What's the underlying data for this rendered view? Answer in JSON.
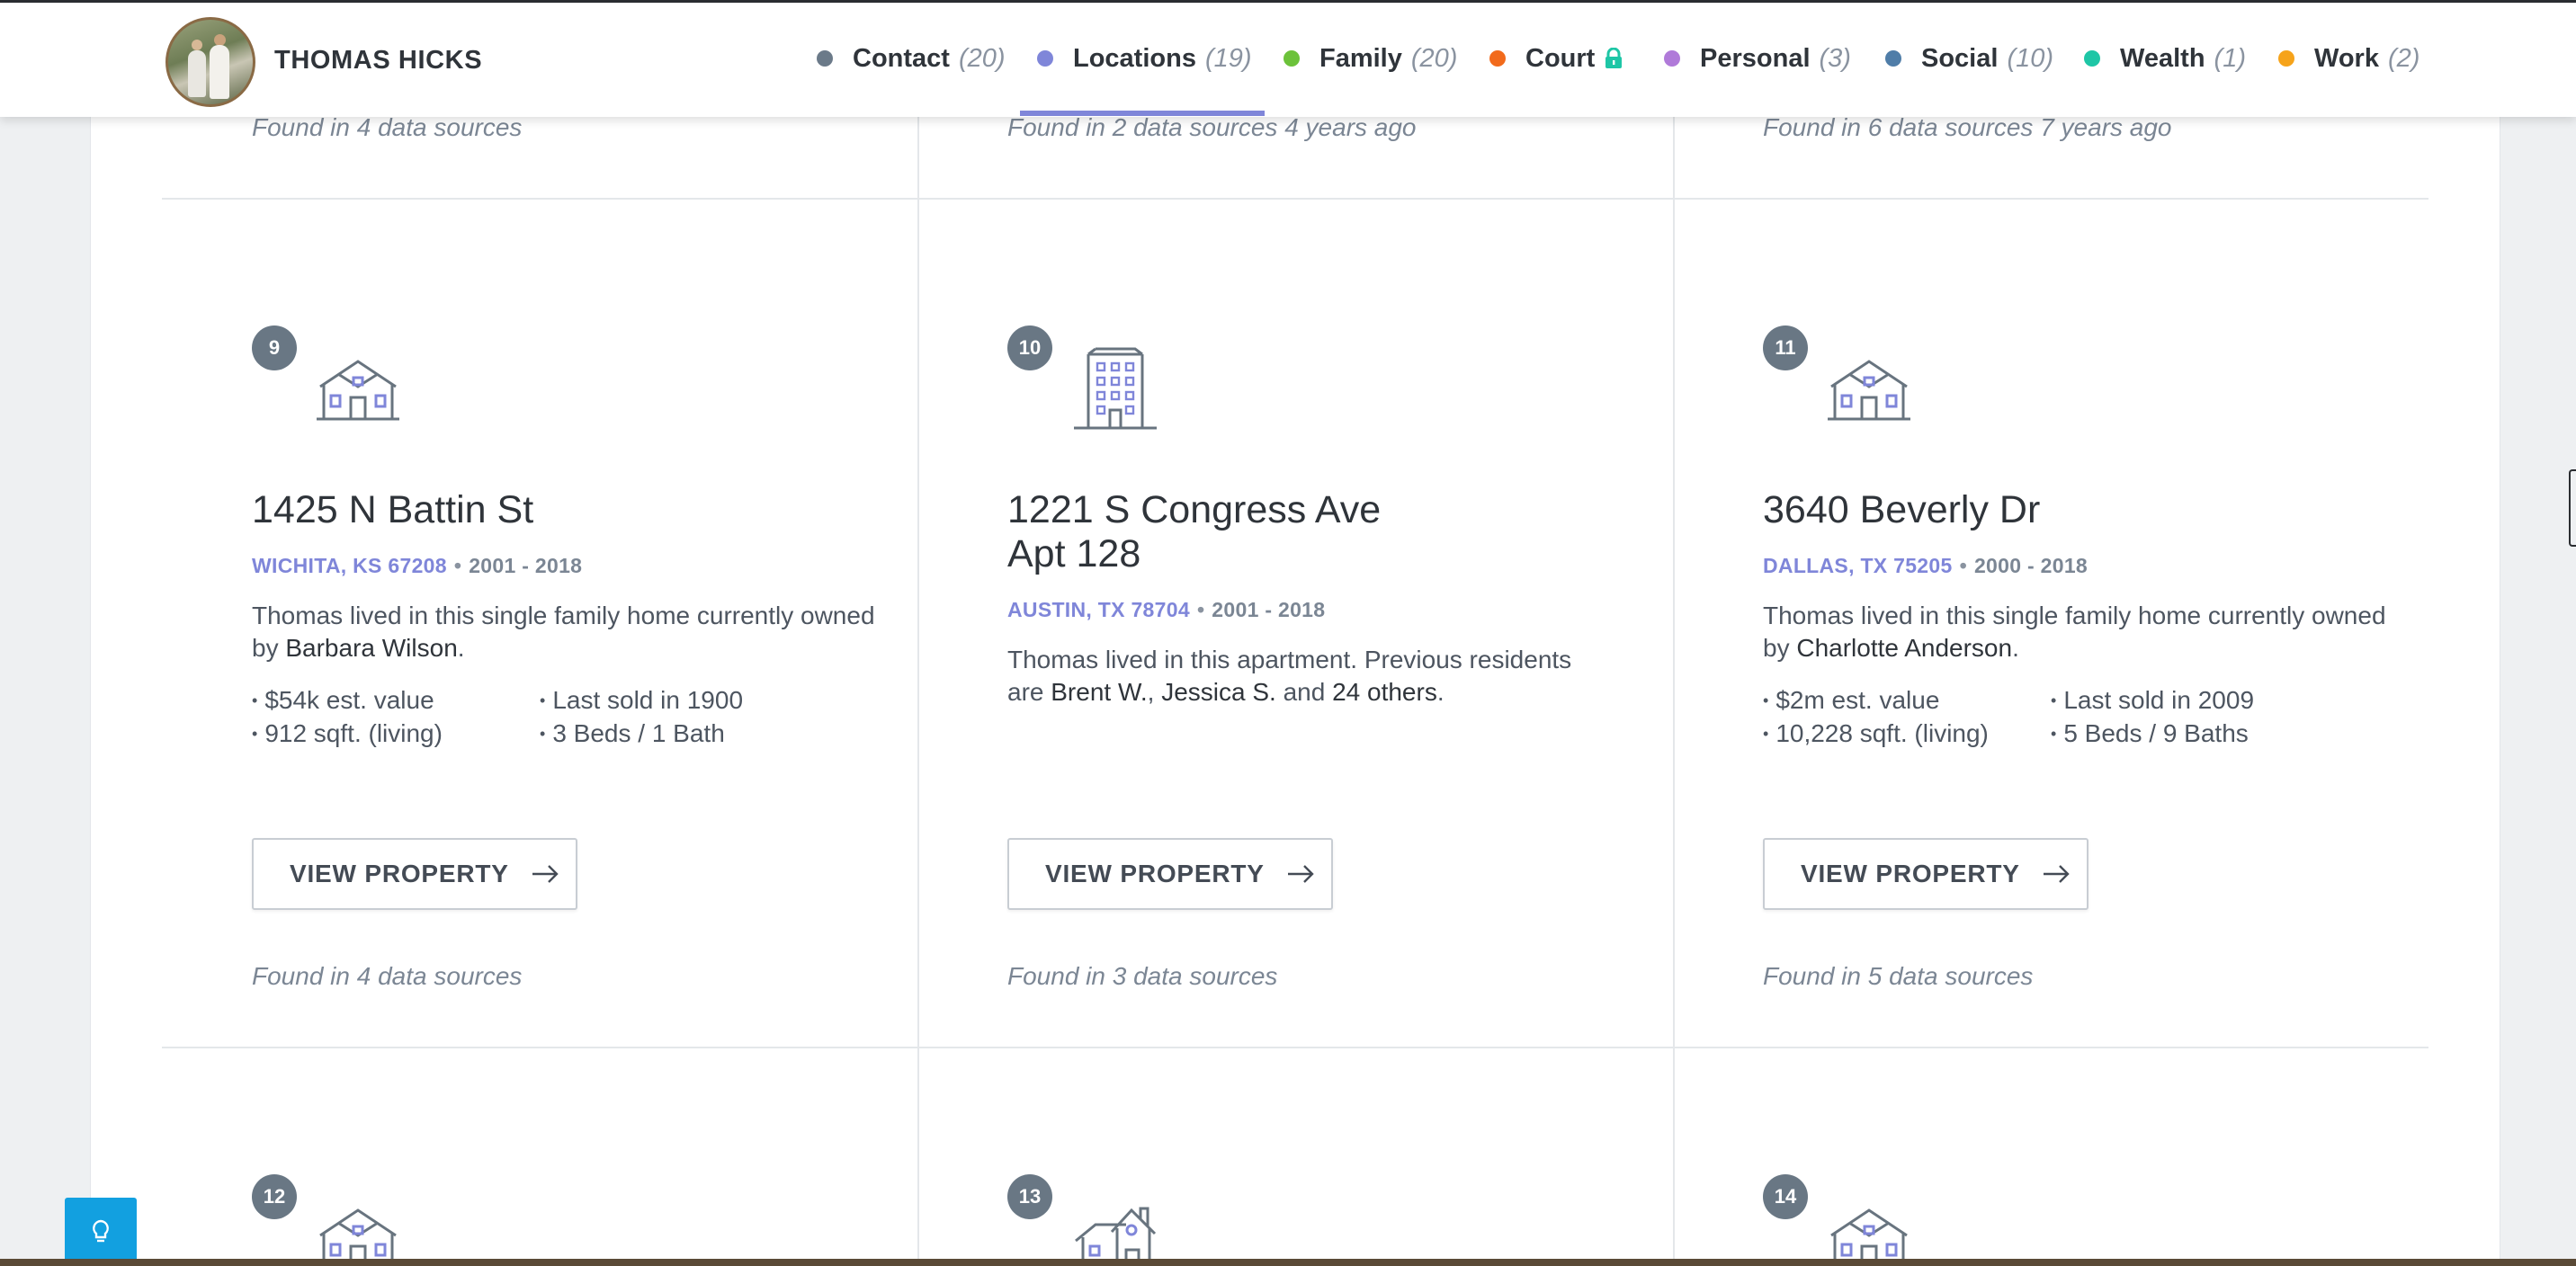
{
  "header": {
    "person_name": "THOMAS HICKS",
    "nav": [
      {
        "label": "Contact",
        "count": "(20)",
        "color": "#6b7a89",
        "icon": "dot"
      },
      {
        "label": "Locations",
        "count": "(19)",
        "color": "#7f86d9",
        "icon": "dot",
        "active": true
      },
      {
        "label": "Family",
        "count": "(20)",
        "color": "#6cc23a",
        "icon": "dot"
      },
      {
        "label": "Court",
        "count": "",
        "color": "#f26a1b",
        "icon": "lock-icon"
      },
      {
        "label": "Personal",
        "count": "(3)",
        "color": "#b07ad9",
        "icon": "dot"
      },
      {
        "label": "Social",
        "count": "(10)",
        "color": "#4f7da8",
        "icon": "dot"
      },
      {
        "label": "Wealth",
        "count": "(1)",
        "color": "#1ec6a6",
        "icon": "dot"
      },
      {
        "label": "Work",
        "count": "(2)",
        "color": "#f6a31a",
        "icon": "dot"
      }
    ]
  },
  "previous_row_found": [
    "Found in 4 data sources",
    "Found in 2 data sources 4 years ago",
    "Found in 6 data sources 7 years ago"
  ],
  "cards": [
    {
      "number": "9",
      "icon": "house-icon",
      "address_line1": "1425 N Battin St",
      "address_line2": "",
      "city": "WICHITA, KS 67208",
      "separator": "•",
      "years": "2001 - 2018",
      "desc_prefix": "Thomas lived in this single family home currently owned by ",
      "desc_owner": "Barbara Wilson",
      "desc_suffix": ".",
      "facts": [
        "$54k est. value",
        "Last sold in 1900",
        "912 sqft. (living)",
        "3 Beds / 1 Bath"
      ],
      "button": "VIEW PROPERTY",
      "found": "Found in 4 data sources"
    },
    {
      "number": "10",
      "icon": "apartment-building-icon",
      "address_line1": "1221 S Congress Ave",
      "address_line2": "Apt 128",
      "city": "AUSTIN, TX 78704",
      "separator": "•",
      "years": "2001 - 2018",
      "desc_prefix": "Thomas lived in this apartment. Previous residents are ",
      "desc_people": [
        "Brent W.",
        "Jessica S."
      ],
      "desc_joiner1": ", ",
      "desc_joiner2": " and ",
      "desc_others": "24 others",
      "desc_suffix": ".",
      "facts": [],
      "button": "VIEW PROPERTY",
      "found": "Found in 3 data sources"
    },
    {
      "number": "11",
      "icon": "house-icon",
      "address_line1": "3640 Beverly Dr",
      "address_line2": "",
      "city": "DALLAS, TX 75205",
      "separator": "•",
      "years": "2000 - 2018",
      "desc_prefix": "Thomas lived in this single family home currently owned by ",
      "desc_owner": "Charlotte Anderson",
      "desc_suffix": ".",
      "facts": [
        "$2m est. value",
        "Last sold in 2009",
        "10,228 sqft. (living)",
        "5 Beds / 9 Baths"
      ],
      "button": "VIEW PROPERTY",
      "found": "Found in 5 data sources"
    }
  ],
  "next_row": [
    {
      "number": "12",
      "icon": "house-icon"
    },
    {
      "number": "13",
      "icon": "cottage-icon"
    },
    {
      "number": "14",
      "icon": "house-icon"
    }
  ],
  "fab": {
    "icon": "lightbulb-icon"
  }
}
